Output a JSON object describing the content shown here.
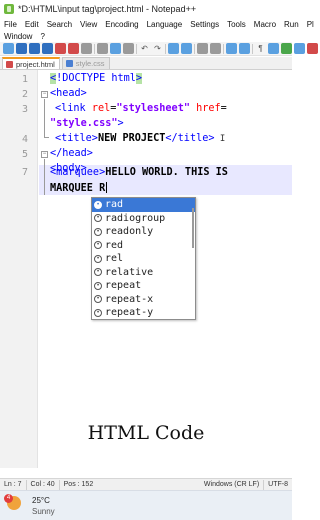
{
  "window": {
    "title": "*D:\\HTML\\input tag\\project.html - Notepad++"
  },
  "menu": {
    "row1": [
      "File",
      "Edit",
      "Search",
      "View",
      "Encoding",
      "Language",
      "Settings",
      "Tools",
      "Macro",
      "Run",
      "Pl"
    ],
    "row2": [
      "Window",
      "?"
    ]
  },
  "tabs": [
    {
      "label": "project.html",
      "active": true
    },
    {
      "label": "style.css",
      "active": false
    }
  ],
  "editor": {
    "line_numbers": [
      "1",
      "2",
      "3",
      "",
      "4",
      "5",
      "6",
      "7",
      ""
    ],
    "lines": {
      "l1_open": "<",
      "l1_tag": "!DOCTYPE html",
      "l1_close": ">",
      "l2": "<head>",
      "l3_open": "<link ",
      "l3_attr1": "rel",
      "l3_eq1": "=",
      "l3_val1": "\"stylesheet\"",
      "l3_attr2": " href",
      "l3_eq2": "=",
      "l3b_val2": "\"style.css\"",
      "l3b_close": ">",
      "l4_open": "<title>",
      "l4_text": "NEW PROJECT",
      "l4_close": "</title>",
      "l5": "</head>",
      "l6": "<body>",
      "l7_open": "<marquee>",
      "l7_text": "HELLO WORLD. THIS IS",
      "l7b_text": "MARQUEE R"
    }
  },
  "autocomplete": {
    "items": [
      "rad",
      "radiogroup",
      "readonly",
      "red",
      "rel",
      "relative",
      "repeat",
      "repeat-x",
      "repeat-y"
    ],
    "selected_index": 0
  },
  "caption": "HTML Code",
  "status": {
    "line": "Ln : 7",
    "col": "Col : 40",
    "pos": "Pos : 152",
    "eol": "Windows (CR LF)",
    "encoding": "UTF-8"
  },
  "taskbar": {
    "weather_badge": "4",
    "temperature": "25°C",
    "condition": "Sunny"
  },
  "colors": {
    "tag": "#0000ff",
    "attribute": "#ff0000",
    "string": "#8000ff",
    "selection": "#3a78d6",
    "active_tab_accent": "#f39a1e"
  }
}
